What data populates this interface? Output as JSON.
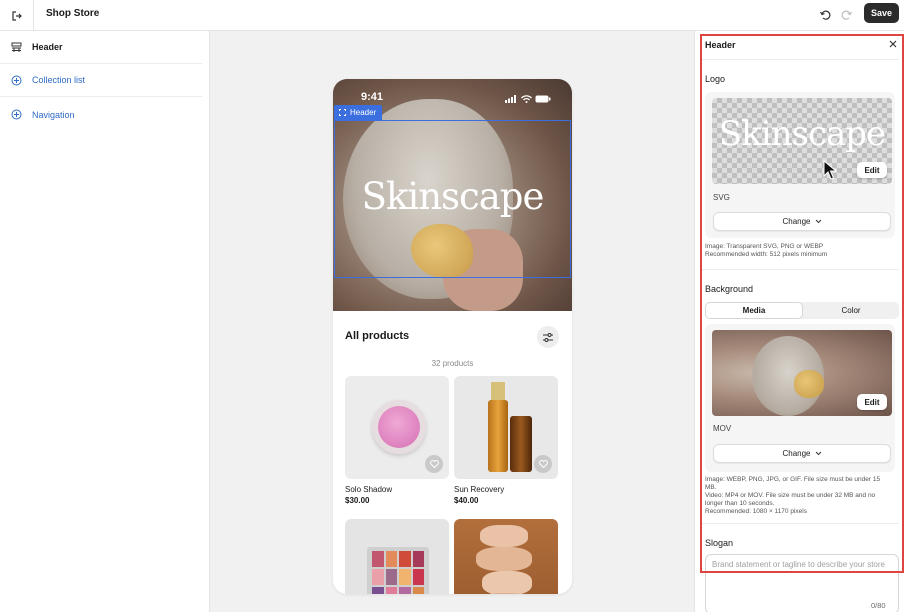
{
  "topbar": {
    "title": "Shop Store",
    "save_label": "Save"
  },
  "sidebar": {
    "items": [
      {
        "label": "Header",
        "icon": "header-layout-icon",
        "state": "selected"
      },
      {
        "label": "Collection list",
        "icon": "plus-circle-icon",
        "state": "add"
      },
      {
        "label": "Navigation",
        "icon": "plus-circle-icon",
        "state": "add"
      }
    ]
  },
  "preview": {
    "time": "9:41",
    "hero_logo": "Skinscape",
    "selection_tag": "Header",
    "products_title": "All products",
    "products_count": "32 products",
    "products": [
      {
        "name": "Solo Shadow",
        "price": "$30.00"
      },
      {
        "name": "Sun Recovery",
        "price": "$40.00"
      }
    ]
  },
  "panel": {
    "title": "Header",
    "logo": {
      "label": "Logo",
      "wordmark": "Skinscape",
      "edit_label": "Edit",
      "file_type": "SVG",
      "change_label": "Change",
      "help_lines": [
        "Image: Transparent SVG, PNG or WEBP",
        "Recommended width: 512 pixels minimum"
      ]
    },
    "background": {
      "label": "Background",
      "tabs": [
        {
          "label": "Media",
          "active": true
        },
        {
          "label": "Color",
          "active": false
        }
      ],
      "edit_label": "Edit",
      "file_type": "MOV",
      "change_label": "Change",
      "help_lines": [
        "Image: WEBP, PNG, JPG, or GIF. File size must be under 15",
        "MB.",
        "Video: MP4 or MOV. File size must be under 32 MB and no",
        "longer than 10 seconds.",
        "Recommended: 1080 × 1170 pixels"
      ]
    },
    "slogan": {
      "label": "Slogan",
      "placeholder": "Brand statement or tagline to describe your store",
      "counter": "0/80"
    }
  },
  "colors": {
    "accent_blue": "#2e6bc6",
    "selection_blue": "#3b6fe0",
    "highlight_red": "#e0443e",
    "save_button": "#2b2b2b"
  }
}
